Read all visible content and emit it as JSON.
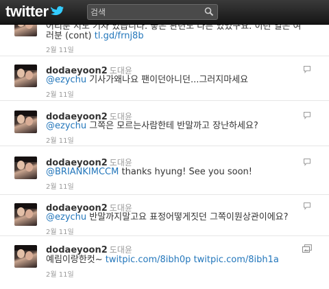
{
  "header": {
    "logo_text": "twitter",
    "search_placeholder": "검색"
  },
  "tweets": [
    {
      "text_line1": "어리분 지도 기자 있습니다. 좋은 관련도 다른 있었구요. 이런 일은 여",
      "text_line2_prefix": "러분 (cont) ",
      "link": "tl.gd/frnj8b",
      "timestamp": "2월 11일"
    },
    {
      "screen_name": "dodaeyoon2",
      "full_name": "도대윤",
      "mention": "@ezychu",
      "text": " 기사가왜나요 팬이던아니던...그러지마세요",
      "timestamp": "2월 11일",
      "icon": "reply-icon"
    },
    {
      "screen_name": "dodaeyoon2",
      "full_name": "도대윤",
      "mention": "@ezychu",
      "text": " 그쪽은 모르는사람한테 반말까고 장난하세요?",
      "timestamp": "2월 11일",
      "icon": "reply-icon"
    },
    {
      "screen_name": "dodaeyoon2",
      "full_name": "도대윤",
      "mention": "@BRIANKIMCCM",
      "text": " thanks hyung! See you soon!",
      "timestamp": "2월 11일",
      "icon": "reply-icon"
    },
    {
      "screen_name": "dodaeyoon2",
      "full_name": "도대윤",
      "mention": "@ezychu",
      "text": " 반말까지말고요 표정어떻게짓던 그쪽이뭔상관이에요?",
      "timestamp": "2월 11일",
      "icon": "reply-icon"
    },
    {
      "screen_name": "dodaeyoon2",
      "full_name": "도대윤",
      "text": "예림이랑한컷~ ",
      "link1": "twitpic.com/8ibh0p",
      "link2": "twitpic.com/8ibh1a",
      "timestamp": "2월 11일",
      "icon": "photo-icon"
    }
  ],
  "colors": {
    "link": "#2276bb",
    "header_bg": "#1e1e1e",
    "meta_gray": "#999999"
  }
}
